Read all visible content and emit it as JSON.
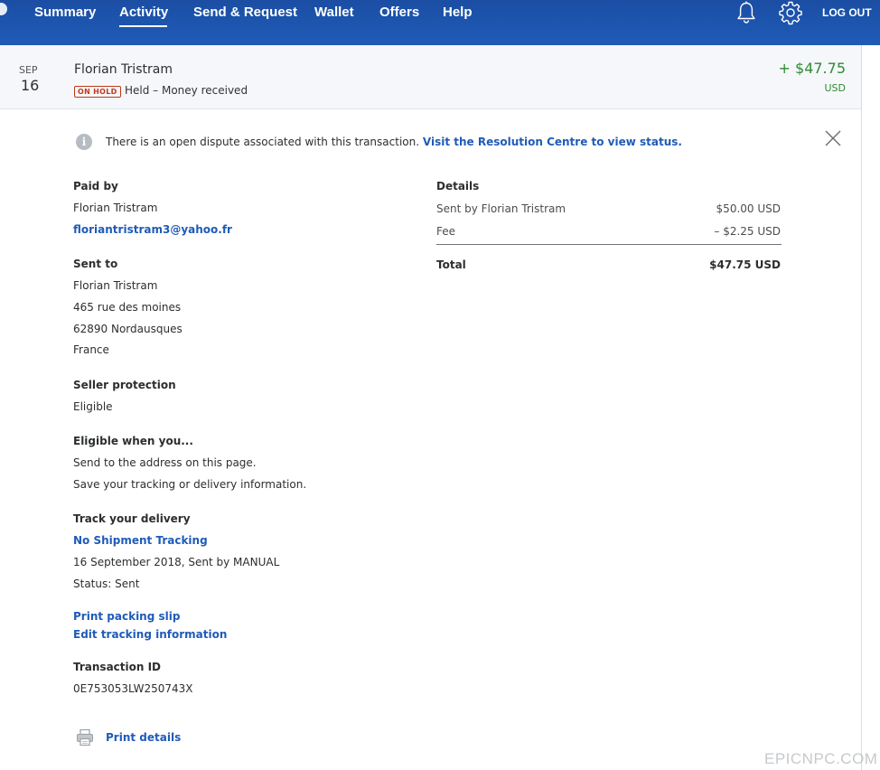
{
  "nav": {
    "items": [
      "Summary",
      "Activity",
      "Send & Request",
      "Wallet",
      "Offers",
      "Help"
    ],
    "active": "Activity",
    "logout_label": "LOG OUT",
    "icons": [
      "bell-icon",
      "gear-icon"
    ]
  },
  "transaction": {
    "month": "SEP",
    "day": "16",
    "name": "Florian Tristram",
    "badge": "ON HOLD",
    "status": "Held – Money received",
    "amount": "+ $47.75",
    "currency": "USD"
  },
  "notice": {
    "text": "There is an open dispute associated with this transaction.",
    "link": "Visit the Resolution Centre to view status."
  },
  "paid_by": {
    "label": "Paid by",
    "name": "Florian Tristram",
    "email": "floriantristram3@yahoo.fr"
  },
  "sent_to": {
    "label": "Sent to",
    "name": "Florian Tristram",
    "address_line1": "465 rue des moines",
    "address_line2": "62890 Nordausques",
    "country": "France"
  },
  "seller_protection": {
    "label": "Seller protection",
    "value": "Eligible"
  },
  "eligible_when": {
    "label": "Eligible when you...",
    "line1": "Send to the address on this page.",
    "line2": "Save your tracking or delivery information."
  },
  "tracking": {
    "label": "Track your delivery",
    "link": "No Shipment Tracking",
    "sent_info": "16 September 2018, Sent by MANUAL",
    "status": "Status: Sent"
  },
  "actions": {
    "print_packing_slip": "Print packing slip",
    "edit_tracking": "Edit tracking information",
    "print_details": "Print details"
  },
  "transaction_id": {
    "label": "Transaction ID",
    "value": "0E753053LW250743X"
  },
  "details": {
    "title": "Details",
    "rows": [
      {
        "label": "Sent by Florian Tristram",
        "amount": "$50.00 USD"
      },
      {
        "label": "Fee",
        "amount": "– $2.25 USD"
      }
    ],
    "total_label": "Total",
    "total_amount": "$47.75 USD"
  },
  "watermark": "EPICNPC.COM",
  "colors": {
    "nav_bg": "#1f5bb8",
    "link": "#1f5bb8",
    "positive_amount": "#2f8a33",
    "on_hold": "#c0391b"
  }
}
